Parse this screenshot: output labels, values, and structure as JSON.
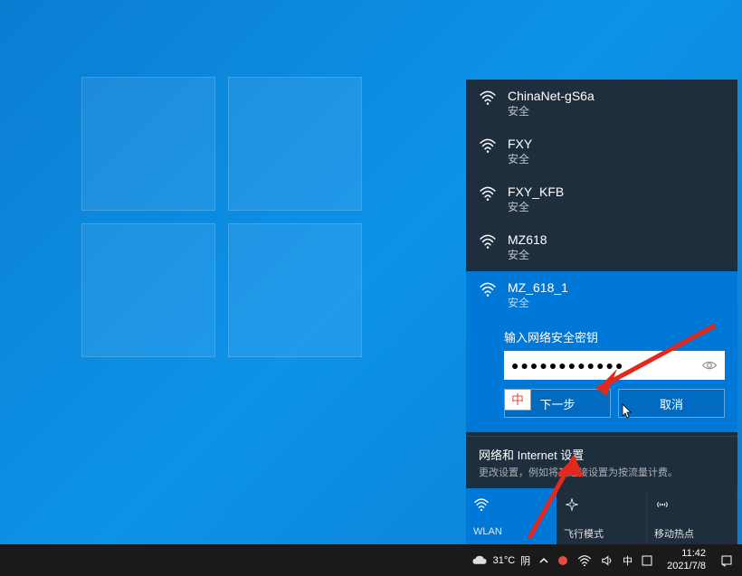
{
  "networks": [
    {
      "name": "ChinaNet-gS6a",
      "status": "安全"
    },
    {
      "name": "FXY",
      "status": "安全"
    },
    {
      "name": "FXY_KFB",
      "status": "安全"
    },
    {
      "name": "MZ618",
      "status": "安全"
    }
  ],
  "selected_network": {
    "name": "MZ_618_1",
    "status": "安全"
  },
  "prompt_label": "输入网络安全密钥",
  "password_masked": "●●●●●●●●●●●●",
  "next_button_label": "下一步",
  "cancel_button_label": "取消",
  "ime_indicator": "中",
  "settings": {
    "title": "网络和 Internet 设置",
    "sub": "更改设置，例如将某连接设置为按流量计费。"
  },
  "tiles": {
    "wlan": "WLAN",
    "airplane": "飞行模式",
    "hotspot": "移动热点"
  },
  "taskbar": {
    "weather_temp": "31°C",
    "weather_cond": "阴",
    "ime_lang": "中",
    "time": "11:42",
    "date": "2021/7/8"
  }
}
